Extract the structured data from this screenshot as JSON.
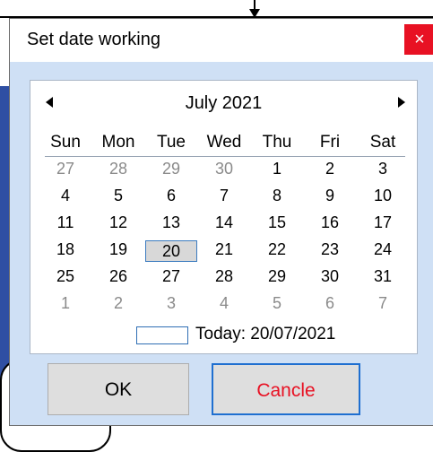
{
  "dialog": {
    "title": "Set date working",
    "close_label": "×"
  },
  "calendar": {
    "month_label": "July 2021",
    "weekdays": [
      "Sun",
      "Mon",
      "Tue",
      "Wed",
      "Thu",
      "Fri",
      "Sat"
    ],
    "weeks": [
      [
        "27",
        "28",
        "29",
        "30",
        "1",
        "2",
        "3"
      ],
      [
        "4",
        "5",
        "6",
        "7",
        "8",
        "9",
        "10"
      ],
      [
        "11",
        "12",
        "13",
        "14",
        "15",
        "16",
        "17"
      ],
      [
        "18",
        "19",
        "20",
        "21",
        "22",
        "23",
        "24"
      ],
      [
        "25",
        "26",
        "27",
        "28",
        "29",
        "30",
        "31"
      ],
      [
        "1",
        "2",
        "3",
        "4",
        "5",
        "6",
        "7"
      ]
    ],
    "today_text": "Today: 20/07/2021"
  },
  "buttons": {
    "ok_label": "OK",
    "cancel_label": "Cancle"
  },
  "icons": {
    "prev": "caret-left-icon",
    "next": "caret-right-icon",
    "close": "close-icon",
    "pointer": "arrow-down-icon"
  },
  "colors": {
    "close_button": "#e81123",
    "dialog_body": "#cfe0f5",
    "cancel_text": "#e81123",
    "focus_border": "#1f6fd0"
  }
}
